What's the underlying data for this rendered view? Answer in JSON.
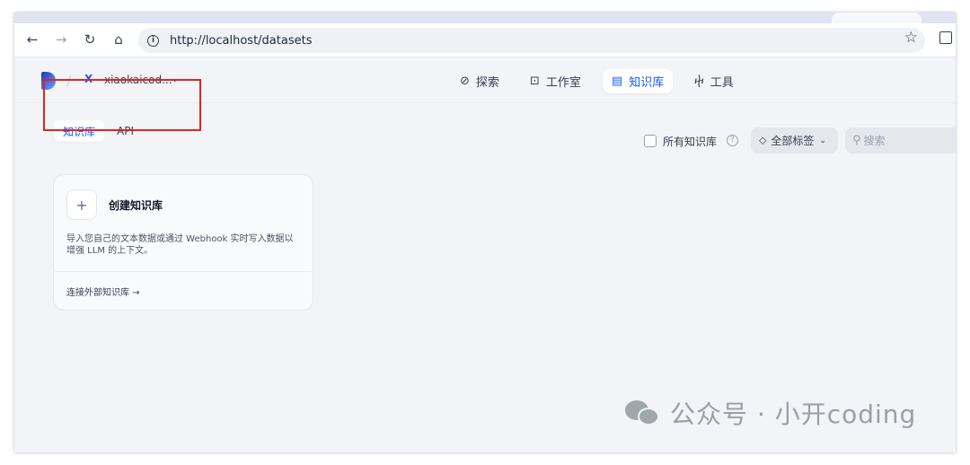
{
  "browser": {
    "url": "http://localhost/datasets",
    "back_icon": "arrow-left-icon",
    "forward_icon": "arrow-right-icon",
    "reload_icon": "reload-icon",
    "home_icon": "home-icon"
  },
  "header": {
    "workspace_badge": "X",
    "workspace_name": "xiaokaicod...",
    "nav": [
      {
        "label": "探索",
        "icon": "explore-icon"
      },
      {
        "label": "工作室",
        "icon": "robot-icon"
      },
      {
        "label": "知识库",
        "icon": "book-icon"
      },
      {
        "label": "工具",
        "icon": "tool-icon"
      }
    ]
  },
  "subtabs": [
    "知识库",
    "API"
  ],
  "filters": {
    "all_datasets_label": "所有知识库",
    "tags_label": "全部标签",
    "search_placeholder": "搜索"
  },
  "card": {
    "create_label": "创建知识库",
    "description": "导入您自己的文本数据或通过 Webhook 实时写入数据以增强 LLM 的上下文。",
    "external_link": "连接外部知识库 →"
  },
  "watermark": "公众号 · 小开coding",
  "colors": {
    "accent": "#155eef",
    "highlight": "#e02424"
  }
}
